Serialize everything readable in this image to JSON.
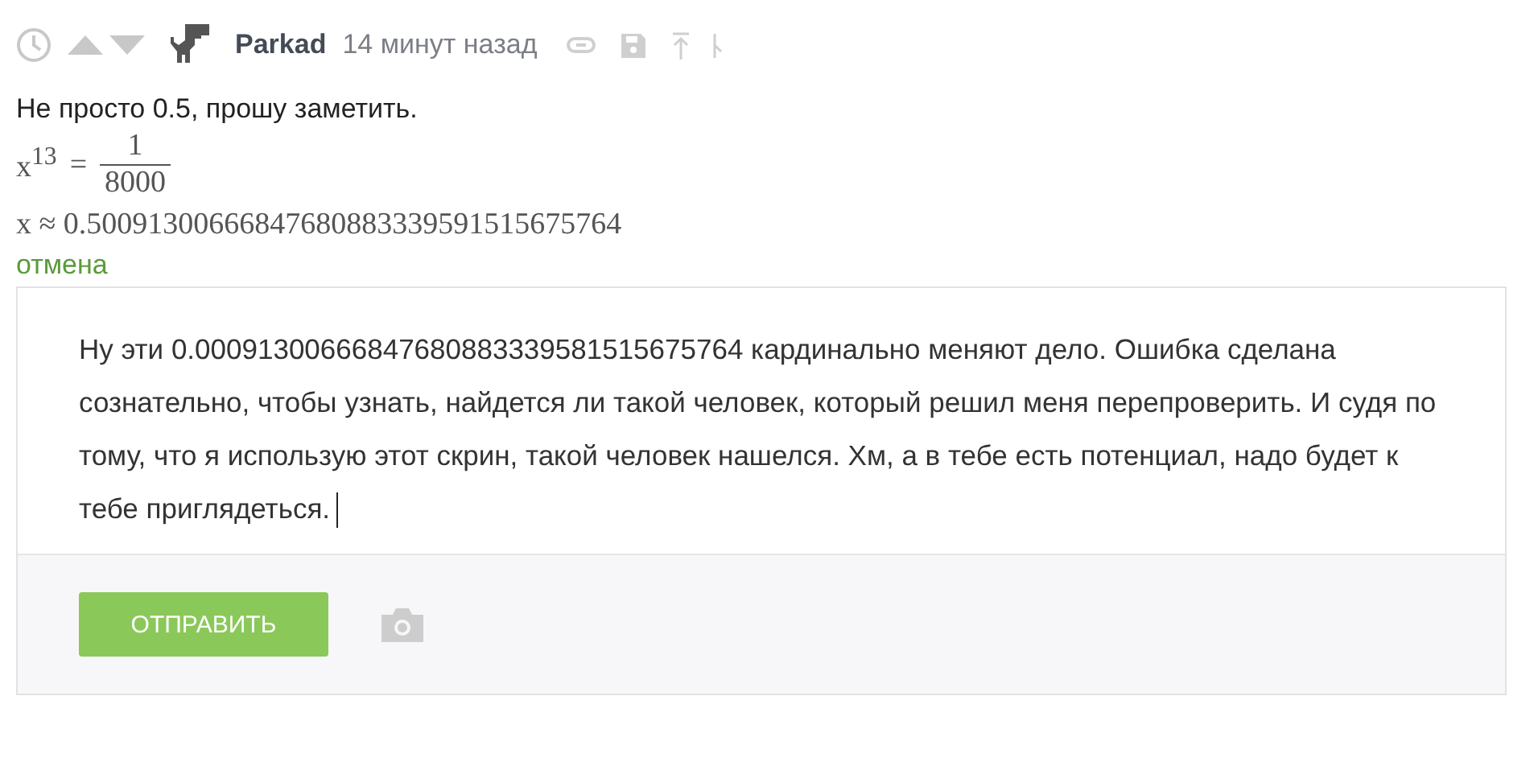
{
  "comment": {
    "votes": {
      "up": false,
      "down": false
    },
    "author": "Parkad",
    "time": "14 минут назад",
    "text": "Не просто 0.5, прошу заметить.",
    "formula": {
      "lhs": "x$^{13}$",
      "relation": "=",
      "numerator": "1",
      "denominator": "8000"
    },
    "approximation": "x ≈ 0.50091300666847680883339591515675764",
    "cancel_link": "отмена"
  },
  "reply": {
    "value": "Ну эти 0.00091300666847680883339581515675764 кардинально меняют дело. Ошибка сделана сознательно, чтобы узнать, найдется ли такой человек, который решил меня перепроверить. И судя по тому, что я использую этот скрин, такой человек нашелся. Хм, а в тебе есть потенциал, надо будет к тебе приглядеться.",
    "submit_button": "ОТПРАВИТЬ"
  }
}
